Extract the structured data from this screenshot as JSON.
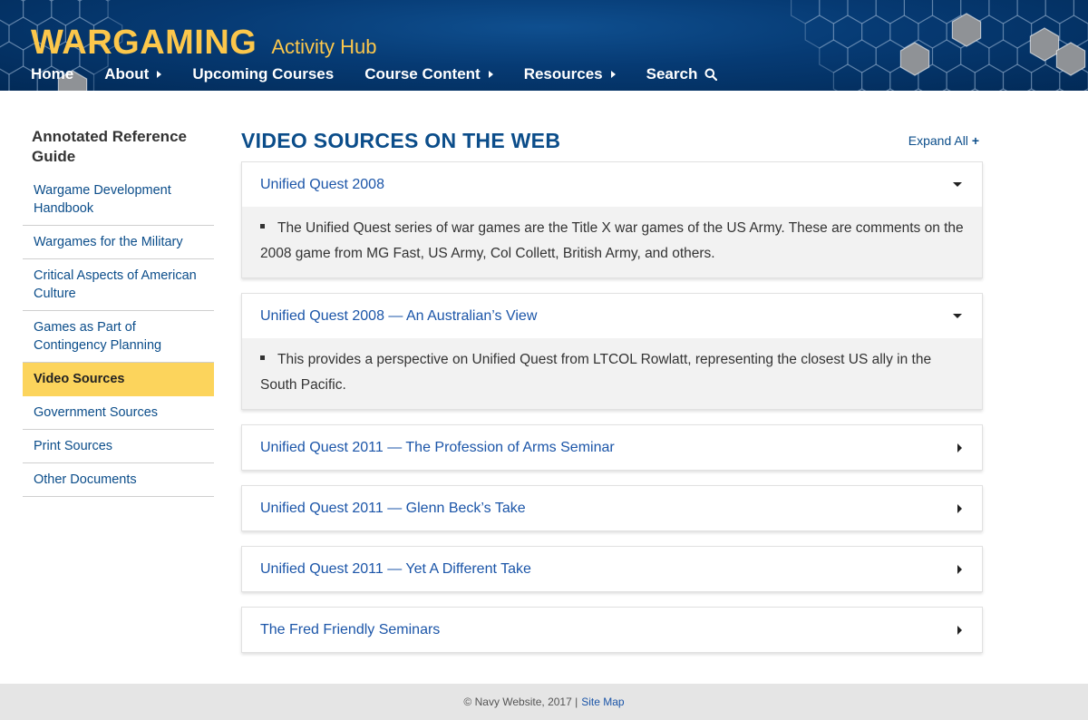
{
  "brand": {
    "main": "WARGAMING",
    "sub": "Activity Hub"
  },
  "nav": [
    {
      "label": "Home",
      "caret": false
    },
    {
      "label": "About",
      "caret": true
    },
    {
      "label": "Upcoming Courses",
      "caret": false
    },
    {
      "label": "Course Content",
      "caret": true
    },
    {
      "label": "Resources",
      "caret": true
    },
    {
      "label": "Search",
      "caret": false,
      "icon": "search-icon"
    }
  ],
  "sidebar": {
    "title": "Annotated Reference Guide",
    "items": [
      {
        "label": "Wargame Development Handbook",
        "active": false
      },
      {
        "label": "Wargames for the Military",
        "active": false
      },
      {
        "label": "Critical Aspects of American Culture",
        "active": false
      },
      {
        "label": "Games as Part of Contingency Planning",
        "active": false
      },
      {
        "label": "Video Sources",
        "active": true
      },
      {
        "label": "Government Sources",
        "active": false
      },
      {
        "label": "Print Sources",
        "active": false
      },
      {
        "label": "Other Documents",
        "active": false
      }
    ]
  },
  "main": {
    "title": "VIDEO SOURCES ON THE WEB",
    "expand_all": "Expand All",
    "expand_icon": "+",
    "accordions": [
      {
        "title": "Unified Quest 2008",
        "open": true,
        "body": "The Unified Quest series of war games are the Title X war games of the US Army. These are comments on the 2008 game from MG Fast, US Army, Col Collett, British Army, and others."
      },
      {
        "title": "Unified Quest 2008 — An Australian’s View",
        "open": true,
        "body": "This provides a perspective on Unified Quest from LTCOL Rowlatt, representing the closest US ally in the South Pacific."
      },
      {
        "title": "Unified Quest 2011 — The Profession of Arms Seminar",
        "open": false,
        "body": ""
      },
      {
        "title": "Unified Quest 2011 — Glenn Beck’s Take",
        "open": false,
        "body": ""
      },
      {
        "title": "Unified Quest 2011 — Yet A Different Take",
        "open": false,
        "body": ""
      },
      {
        "title": "The Fred Friendly Seminars",
        "open": false,
        "body": ""
      }
    ]
  },
  "footer": {
    "copyright": "© Navy Website, 2017 |",
    "sitemap": "Site Map"
  },
  "colors": {
    "header": "#063a73",
    "brand": "#fcc74b",
    "link": "#1b55a8",
    "active": "#fcd45c"
  }
}
